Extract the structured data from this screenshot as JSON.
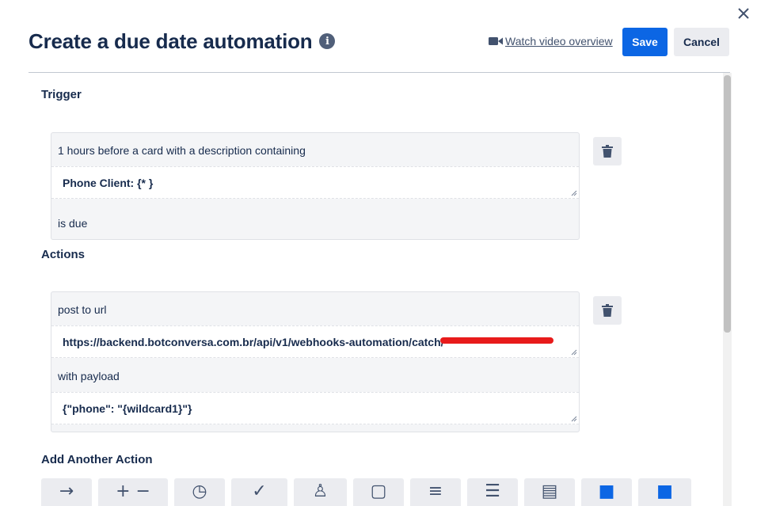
{
  "dialog": {
    "title": "Create a due date automation",
    "info_icon": "info-icon",
    "video_link_label": "Watch video overview",
    "save_label": "Save",
    "cancel_label": "Cancel"
  },
  "trigger": {
    "section_label": "Trigger",
    "line1": "1 hours before a card with a description containing",
    "input_value": "Phone Client: {* }",
    "line2": "is due"
  },
  "actions": {
    "section_label": "Actions",
    "line1": "post to url",
    "url_value": "https://backend.botconversa.com.br/api/v1/webhooks-automation/catch/",
    "line2": "with payload",
    "payload_value": "{\"phone\": \"{wildcard1}\"}"
  },
  "add_action": {
    "section_label": "Add Another Action",
    "buttons": [
      {
        "icon": "arrow-right-icon",
        "glyph": "→"
      },
      {
        "icon": "add-remove-icon",
        "glyph": "+ −"
      },
      {
        "icon": "clock-icon",
        "glyph": "◷"
      },
      {
        "icon": "checkmark-icon",
        "glyph": "✓"
      },
      {
        "icon": "member-icon",
        "glyph": "♙"
      },
      {
        "icon": "comment-icon",
        "glyph": "▢"
      },
      {
        "icon": "description-icon",
        "glyph": "≡"
      },
      {
        "icon": "align-center-icon",
        "glyph": "☰"
      },
      {
        "icon": "archive-icon",
        "glyph": "▤"
      },
      {
        "icon": "power-up-icon",
        "glyph": "■"
      },
      {
        "icon": "card-icon",
        "glyph": "■"
      }
    ]
  },
  "colors": {
    "primary": "#0c66e4",
    "redaction": "#e81b1b",
    "card_bg": "#f4f5f7"
  }
}
